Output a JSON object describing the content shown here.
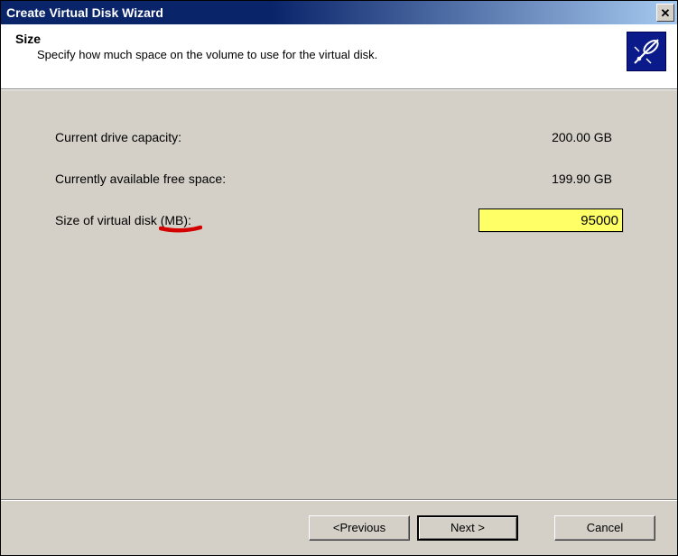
{
  "titlebar": {
    "title": "Create Virtual Disk Wizard"
  },
  "header": {
    "title": "Size",
    "subtitle": "Specify how much space on the volume to use for the virtual disk."
  },
  "content": {
    "capacity_label": "Current drive capacity:",
    "capacity_value": "200.00 GB",
    "freespace_label": "Currently available free space:",
    "freespace_value": "199.90 GB",
    "size_label_prefix": "Size of virtual disk ",
    "size_label_unit": "(MB)",
    "size_label_suffix": ":",
    "size_value": "95000"
  },
  "footer": {
    "previous": "<Previous",
    "next": "Next >",
    "cancel": "Cancel"
  }
}
